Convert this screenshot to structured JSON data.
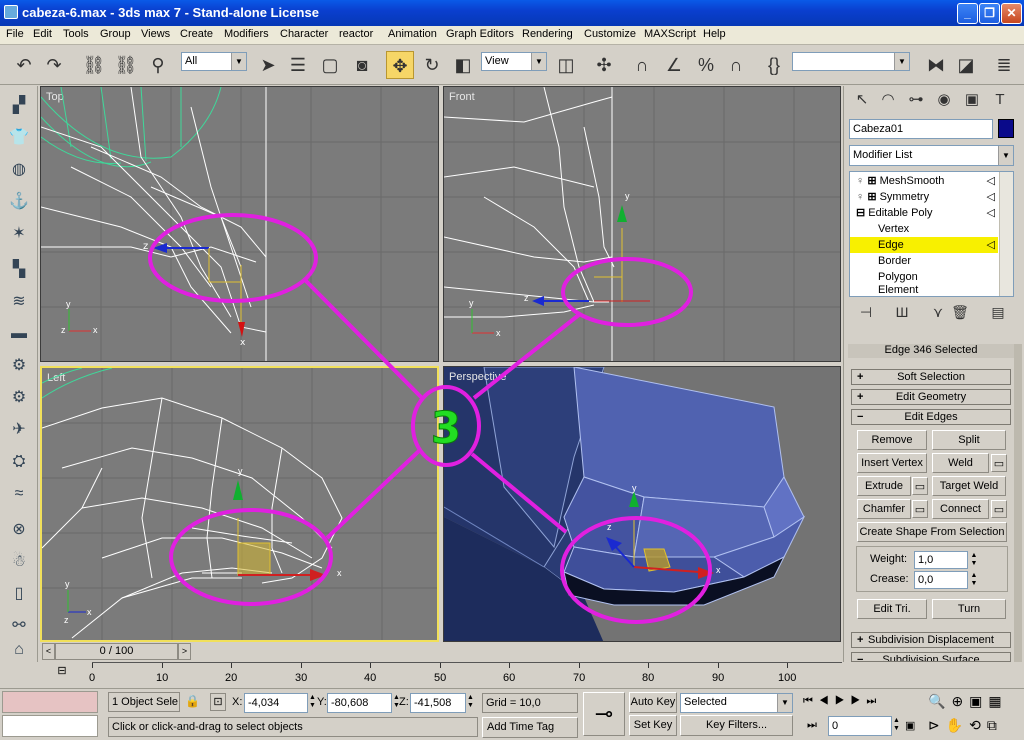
{
  "window": {
    "title": "cabeza-6.max - 3ds max 7 - Stand-alone License",
    "buttons": {
      "minimize": "_",
      "maximize": "❐",
      "close": "✕"
    }
  },
  "menu": [
    "File",
    "Edit",
    "Tools",
    "Group",
    "Views",
    "Create",
    "Modifiers",
    "Character",
    "reactor",
    "Animation",
    "Graph Editors",
    "Rendering",
    "Customize",
    "MAXScript",
    "Help"
  ],
  "toolbar": {
    "selection_filter": "All",
    "reference_coord": "View",
    "named_selection": ""
  },
  "viewports": {
    "top": "Top",
    "front": "Front",
    "left": "Left",
    "perspective": "Perspective"
  },
  "annotation": {
    "number": "3",
    "color": "#e020e0",
    "number_color": "#22dd22"
  },
  "axis_labels": {
    "x": "x",
    "y": "y",
    "z": "z"
  },
  "command_panel": {
    "object_name": "Cabeza01",
    "object_color": "#0a0a8a",
    "modifier_list": "Modifier List",
    "stack": [
      {
        "label": "MeshSmooth",
        "type": "modifier"
      },
      {
        "label": "Symmetry",
        "type": "modifier"
      },
      {
        "label": "Editable Poly",
        "type": "base"
      },
      {
        "label": "Vertex",
        "type": "sub"
      },
      {
        "label": "Edge",
        "type": "sub",
        "selected": true
      },
      {
        "label": "Border",
        "type": "sub"
      },
      {
        "label": "Polygon",
        "type": "sub"
      },
      {
        "label": "Element",
        "type": "sub"
      }
    ],
    "selection_info": "Edge 346 Selected",
    "rollouts": {
      "soft_selection": "Soft Selection",
      "edit_geometry": "Edit Geometry",
      "edit_edges": "Edit Edges",
      "subdivision_displacement": "Subdivision Displacement",
      "subdivision_surface": "Subdivision Surface"
    },
    "edit_edges": {
      "remove": "Remove",
      "split": "Split",
      "insert_vertex": "Insert Vertex",
      "weld": "Weld",
      "extrude": "Extrude",
      "target_weld": "Target Weld",
      "chamfer": "Chamfer",
      "connect": "Connect",
      "create_shape": "Create Shape From Selection",
      "weight_label": "Weight:",
      "weight_value": "1,0",
      "crease_label": "Crease:",
      "crease_value": "0,0",
      "edit_tri": "Edit Tri.",
      "turn": "Turn"
    }
  },
  "timeline": {
    "slider_label": "0 / 100",
    "ticks": [
      "0",
      "10",
      "20",
      "30",
      "40",
      "50",
      "60",
      "70",
      "80",
      "90",
      "100"
    ]
  },
  "status": {
    "selection": "1 Object Sele",
    "x_label": "X:",
    "x_value": "-4,034",
    "y_label": "Y:",
    "y_value": "-80,608",
    "z_label": "Z:",
    "z_value": "-41,508",
    "grid": "Grid = 10,0",
    "prompt": "Click or click-and-drag to select objects",
    "add_time_tag": "Add Time Tag",
    "auto_key": "Auto Key",
    "set_key": "Set Key",
    "key_mode": "Selected",
    "key_filters": "Key Filters...",
    "frame": "0"
  }
}
